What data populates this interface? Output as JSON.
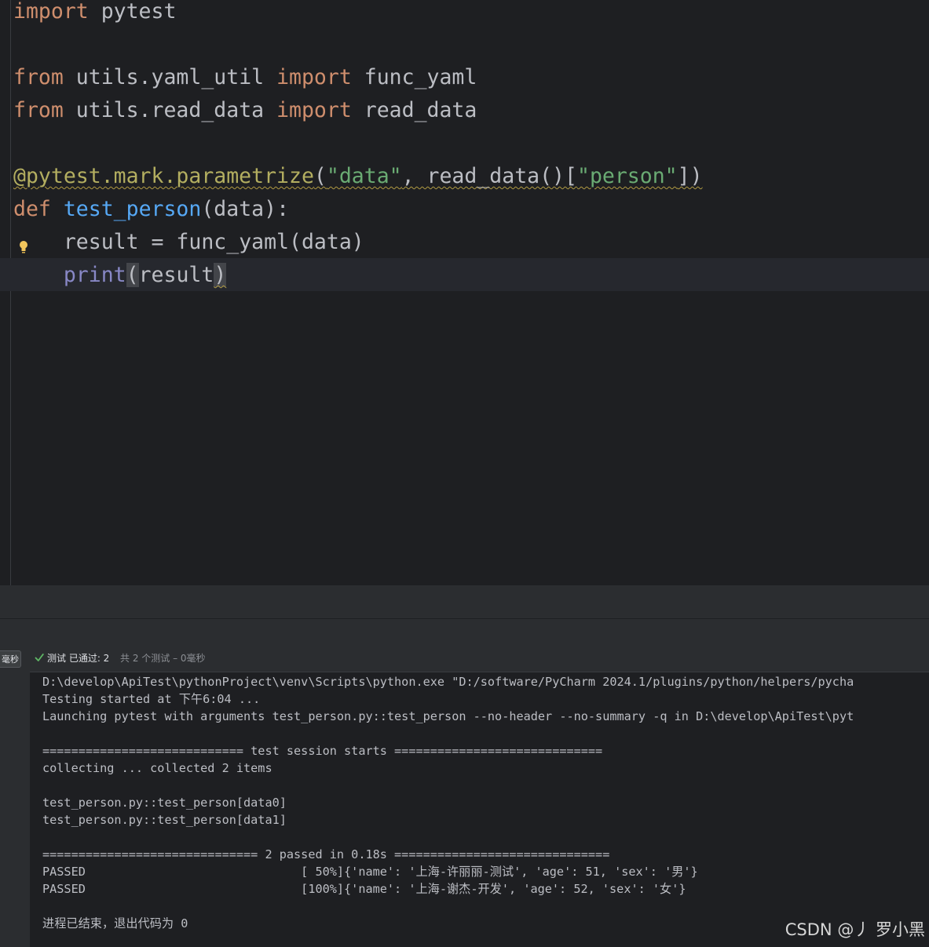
{
  "editor": {
    "lines": {
      "l1": {
        "kw_import": "import",
        "rest": " pytest"
      },
      "l3": {
        "kw_from": "from",
        "module": " utils.yaml_util ",
        "kw_import": "import",
        "name": " func_yaml"
      },
      "l4": {
        "kw_from": "from",
        "module": " utils.read_data ",
        "kw_import": "import",
        "name": " read_data"
      },
      "l6": {
        "decorator": "@pytest.mark.parametrize",
        "open": "(",
        "str_data": "\"data\"",
        "mid": ", read_data()[",
        "str_person": "\"person\"",
        "close": "])"
      },
      "l7": {
        "kw_def": "def",
        "space": " ",
        "fn_name": "test_person",
        "params": "(data):"
      },
      "l8": {
        "indent": "    ",
        "code": "result = func_yaml(data)"
      },
      "l9": {
        "indent": "    ",
        "builtin": "print",
        "open": "(",
        "arg": "result",
        "close": ")"
      }
    }
  },
  "run_panel": {
    "duration_badge": "毫秒",
    "status_label": "测试 已通过: 2",
    "status_detail": "共 2 个测试 – 0毫秒"
  },
  "console": {
    "lines": [
      "D:\\develop\\ApiTest\\pythonProject\\venv\\Scripts\\python.exe \"D:/software/PyCharm 2024.1/plugins/python/helpers/pycha",
      "Testing started at 下午6:04 ...",
      "Launching pytest with arguments test_person.py::test_person --no-header --no-summary -q in D:\\develop\\ApiTest\\pyt",
      "",
      "============================ test session starts =============================",
      "collecting ... collected 2 items",
      "",
      "test_person.py::test_person[data0]",
      "test_person.py::test_person[data1]",
      "",
      "============================== 2 passed in 0.18s ==============================",
      "PASSED                              [ 50%]{'name': '上海-许丽丽-测试', 'age': 51, 'sex': '男'}",
      "PASSED                              [100%]{'name': '上海-谢杰-开发', 'age': 52, 'sex': '女'}",
      "",
      "进程已结束，退出代码为 0"
    ]
  },
  "watermark": "CSDN @丿 罗小黑",
  "colors": {
    "background": "#1e1f22",
    "keyword": "#cf8e6d",
    "string": "#6aab73",
    "decorator": "#b3ae60",
    "function": "#56a8f5",
    "builtin": "#8888c6",
    "text": "#bcbec4",
    "success": "#5fb865"
  }
}
